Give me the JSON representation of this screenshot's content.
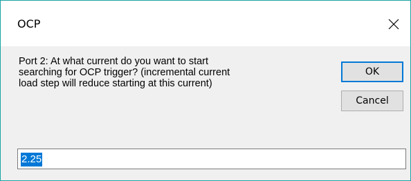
{
  "dialog": {
    "title": "OCP",
    "prompt": "Port 2: At what current do you want to start\nsearching for OCP trigger? (incremental current\nload step will reduce starting at this current)",
    "input_value": "2.25",
    "ok_label": "OK",
    "cancel_label": "Cancel",
    "close_icon": "close-icon"
  },
  "colors": {
    "window_border": "#18a3a3",
    "selection": "#0078d7",
    "dialog_background": "#f0f0f0"
  }
}
